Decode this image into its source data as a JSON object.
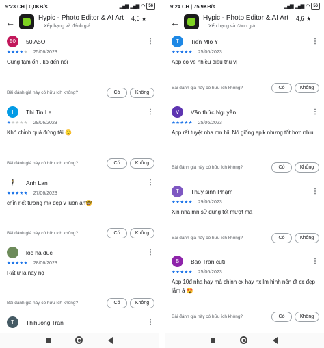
{
  "app": {
    "title": "Hypic - Photo Editor & AI Art",
    "rating": "4,6",
    "subtitle": "Xếp hạng và đánh giá"
  },
  "helpful": {
    "question": "Bài đánh giá này có hữu ích không?",
    "yes": "Có",
    "no": "Không"
  },
  "colors": {
    "star": "#1a73e8",
    "star_empty": "#c4c7c5"
  },
  "left": {
    "status": {
      "time": "9:23 CH",
      "speed": "0,0KB/s",
      "battery": "56"
    },
    "reviews": [
      {
        "initial": "50",
        "author": "50 A5O",
        "stars": 4,
        "date": "25/06/2023",
        "text": "Cũng tạm ổn , ko đến nổi",
        "avatar_color": "#c2185b"
      },
      {
        "initial": "T",
        "author": "Thi Tin Le",
        "stars": 1,
        "date": "29/06/2023",
        "text": "Khó chỉnh quá đứng tải 🙁",
        "avatar_color": "#039be5"
      },
      {
        "initial": "🕴",
        "author": "Anh Lan",
        "stars": 5,
        "date": "27/06/2023",
        "text": "chỉn riết tướng mk đẹp v luôn áh🤓",
        "avatar_color": "#ffffff"
      },
      {
        "initial": "",
        "author": "loc ha duc",
        "stars": 5,
        "date": "28/06/2023",
        "text": "Rất ư là này nọ",
        "avatar_color": "#6d8b5a"
      },
      {
        "initial": "T",
        "author": "Thihuong Tran",
        "stars": 0,
        "date": "",
        "text": "",
        "avatar_color": "#455a64"
      }
    ]
  },
  "right": {
    "status": {
      "time": "9:24 CH",
      "speed": "75,9KB/s",
      "battery": "56"
    },
    "reviews": [
      {
        "initial": "T",
        "author": "Tiến Mlo Y",
        "stars": 5,
        "date": "25/06/2023",
        "text": "App có vẻ nhiều điều thú vị",
        "avatar_color": "#1e88e5"
      },
      {
        "initial": "V",
        "author": "Văn thức Nguyễn",
        "stars": 5,
        "date": "25/06/2023",
        "text": "App rất tuyệt nha mn hiii Nó giống epik nhưng tốt hơn nhiu",
        "avatar_color": "#5e35b1"
      },
      {
        "initial": "T",
        "author": "Thuý sinh Phạm",
        "stars": 5,
        "date": "29/06/2023",
        "text": "Xịn nha mn sử dụng tốt mượt mà",
        "avatar_color": "#7e57c2"
      },
      {
        "initial": "B",
        "author": "Bao Tran cuti",
        "stars": 5,
        "date": "25/06/2023",
        "text": "App 10đ nha hay mà chỉnh cx hay nx lm hình nền đt cx đẹp lắm á 😍",
        "avatar_color": "#8e24aa"
      }
    ]
  }
}
